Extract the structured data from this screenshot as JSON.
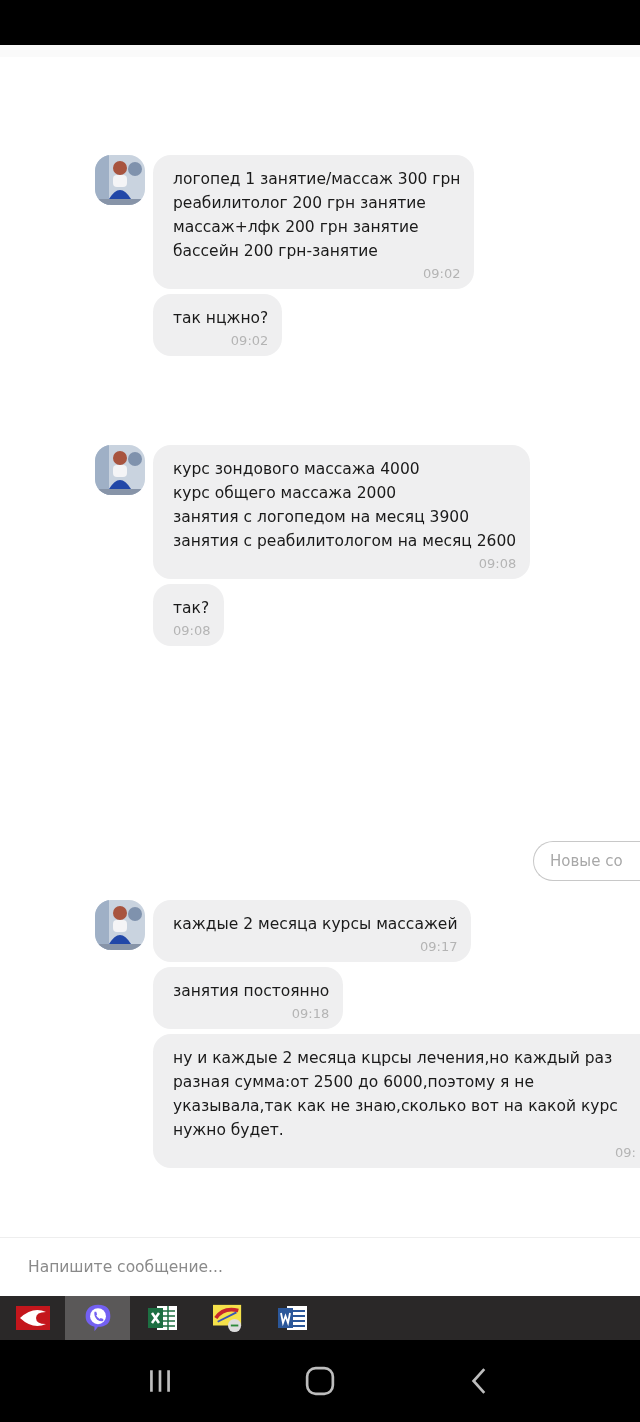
{
  "groups": [
    {
      "messages": [
        {
          "text": "логопед 1 занятие/массаж 300 грн\nреабилитолог 200 грн занятие\nмассаж+лфк 200 грн занятие\nбассейн 200 грн-занятие",
          "time": "09:02"
        },
        {
          "text": "так нцжно?",
          "time": "09:02"
        }
      ]
    },
    {
      "messages": [
        {
          "text": "курс зондового массажа 4000\nкурс общего массажа 2000\nзанятия с логопедом на месяц 3900\nзанятия с реабилитологом на месяц 2600",
          "time": "09:08"
        },
        {
          "text": "так?",
          "time": "09:08"
        }
      ]
    },
    {
      "new_messages_label": "Новые со",
      "messages": [
        {
          "text": "каждые 2 месяца курсы массажей",
          "time": "09:17"
        },
        {
          "text": "занятия постоянно",
          "time": "09:18"
        },
        {
          "text": "ну и каждые 2 месяца кцрсы лечения,но каждый раз разная сумма:от 2500 до 6000,поэтому я не указывала,так как не знаю,сколько вот на какой курс нужно будет.",
          "time": "09:",
          "wide": true
        }
      ]
    }
  ],
  "composer": {
    "placeholder": "Напишите сообщение..."
  },
  "taskbar": [
    {
      "kind": "reader",
      "selected": false
    },
    {
      "kind": "viber",
      "selected": true
    },
    {
      "kind": "sheet",
      "selected": false
    },
    {
      "kind": "ledger",
      "selected": false
    },
    {
      "kind": "word",
      "selected": false
    }
  ]
}
